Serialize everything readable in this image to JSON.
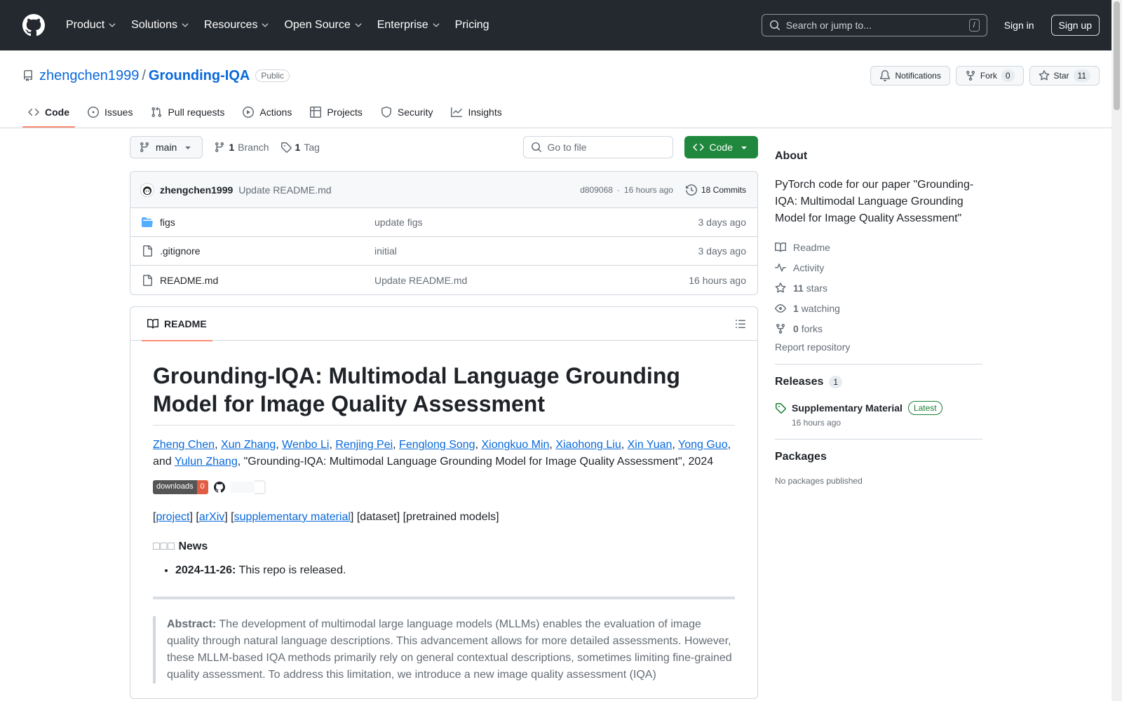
{
  "header": {
    "nav": [
      "Product",
      "Solutions",
      "Resources",
      "Open Source",
      "Enterprise",
      "Pricing"
    ],
    "search_placeholder": "Search or jump to...",
    "search_key": "/",
    "signin": "Sign in",
    "signup": "Sign up"
  },
  "repo": {
    "owner": "zhengchen1999",
    "separator": "/",
    "name": "Grounding-IQA",
    "visibility": "Public",
    "notifications": "Notifications",
    "fork_label": "Fork",
    "fork_count": "0",
    "star_label": "Star",
    "star_count": "11"
  },
  "tabs": [
    "Code",
    "Issues",
    "Pull requests",
    "Actions",
    "Projects",
    "Security",
    "Insights"
  ],
  "branchbar": {
    "branch": "main",
    "branch_count": "1",
    "branch_label": "Branch",
    "tag_count": "1",
    "tag_label": "Tag",
    "goto_placeholder": "Go to file",
    "code_button": "Code"
  },
  "commit": {
    "author": "zhengchen1999",
    "message": "Update README.md",
    "hash": "d809068",
    "dot": "·",
    "time": "16 hours ago",
    "commits": "18 Commits"
  },
  "files": [
    {
      "name": "figs",
      "type": "folder",
      "message": "update figs",
      "date": "3 days ago"
    },
    {
      "name": ".gitignore",
      "type": "file",
      "message": "initial",
      "date": "3 days ago"
    },
    {
      "name": "README.md",
      "type": "file",
      "message": "Update README.md",
      "date": "16 hours ago"
    }
  ],
  "readme": {
    "tab": "README",
    "title": "Grounding-IQA: Multimodal Language Grounding Model for Image Quality Assessment",
    "authors": [
      "Zheng Chen",
      "Xun Zhang",
      "Wenbo Li",
      "Renjing Pei",
      "Fenglong Song",
      "Xiongkuo Min",
      "Xiaohong Liu",
      "Xin Yuan",
      "Yong Guo"
    ],
    "authors_and": "and",
    "last_author": "Yulun Zhang",
    "citation": ", \"Grounding-IQA: Multimodal Language Grounding Model for Image Quality Assessment\", 2024",
    "badge_label": "downloads",
    "badge_value": "0",
    "links": {
      "project": "project",
      "arxiv": "arXiv",
      "supp": "supplementary material",
      "dataset": "[dataset]",
      "models": "[pretrained models]"
    },
    "news_emoji": "□□□",
    "news_title": "News",
    "news_items": [
      {
        "date": "2024-11-26:",
        "text": " This repo is released."
      }
    ],
    "abstract_label": "Abstract:",
    "abstract_text": " The development of multimodal large language models (MLLMs) enables the evaluation of image quality through natural language descriptions. This advancement allows for more detailed assessments. However, these MLLM-based IQA methods primarily rely on general contextual descriptions, sometimes limiting fine-grained quality assessment. To address this limitation, we introduce a new image quality assessment (IQA)"
  },
  "sidebar": {
    "about_title": "About",
    "description": "PyTorch code for our paper \"Grounding-IQA: Multimodal Language Grounding Model for Image Quality Assessment\"",
    "readme": "Readme",
    "activity": "Activity",
    "stars_count": "11",
    "stars_label": "stars",
    "watching_count": "1",
    "watching_label": "watching",
    "forks_count": "0",
    "forks_label": "forks",
    "report": "Report repository",
    "releases_title": "Releases",
    "releases_count": "1",
    "release_name": "Supplementary Material",
    "release_badge": "Latest",
    "release_date": "16 hours ago",
    "packages_title": "Packages",
    "packages_empty": "No packages published"
  },
  "colors": {
    "header_bg": "#24292f",
    "link": "#0969da",
    "code_button": "#1f883d",
    "tab_underline": "#fd8c73",
    "release_green": "#1a7f37"
  }
}
